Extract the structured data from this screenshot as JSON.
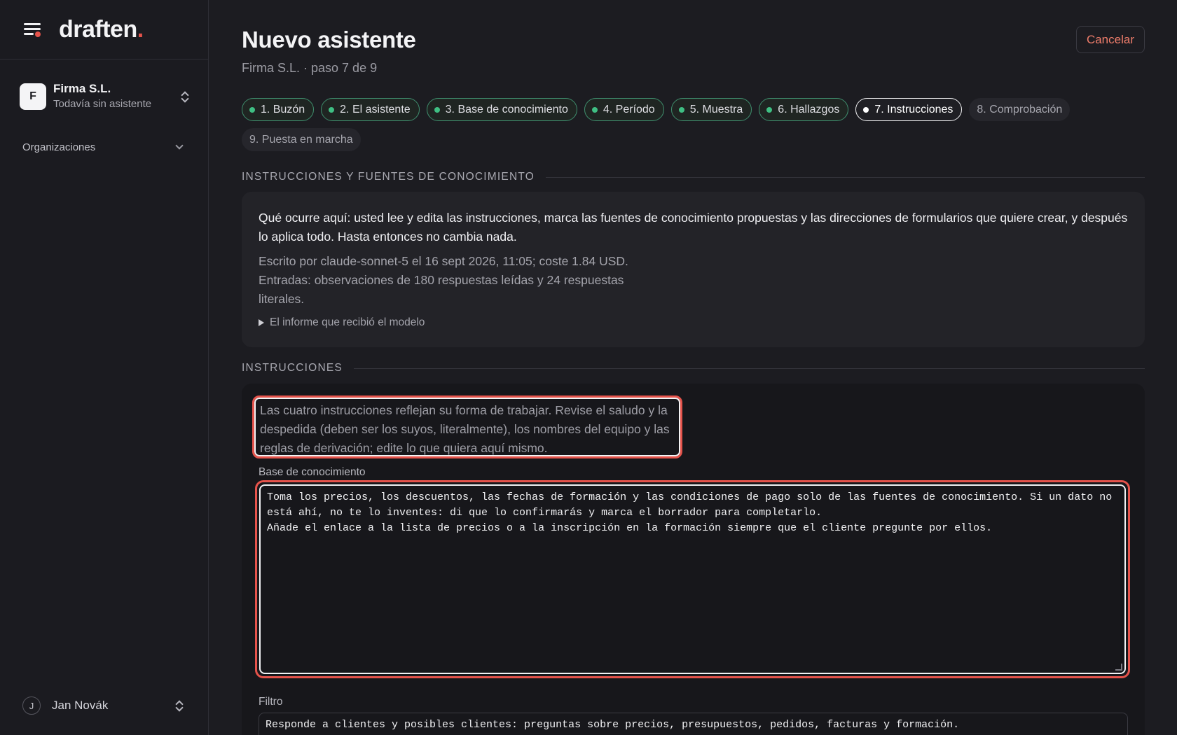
{
  "app": {
    "logo": "draften",
    "logo_dot": "."
  },
  "sidebar": {
    "org": {
      "initial": "F",
      "name": "Firma S.L.",
      "subtitle": "Todavía sin asistente"
    },
    "section_label": "Organizaciones",
    "user": {
      "initial": "J",
      "name": "Jan Novák"
    }
  },
  "header": {
    "title": "Nuevo asistente",
    "subtitle": "Firma S.L. · paso 7 de 9",
    "cancel_label": "Cancelar"
  },
  "steps": [
    {
      "label": "1. Buzón",
      "state": "done"
    },
    {
      "label": "2. El asistente",
      "state": "done"
    },
    {
      "label": "3. Base de conocimiento",
      "state": "done"
    },
    {
      "label": "4. Período",
      "state": "done"
    },
    {
      "label": "5. Muestra",
      "state": "done"
    },
    {
      "label": "6. Hallazgos",
      "state": "done"
    },
    {
      "label": "7. Instrucciones",
      "state": "active"
    },
    {
      "label": "8. Comprobación",
      "state": "todo"
    },
    {
      "label": "9. Puesta en marcha",
      "state": "todo"
    }
  ],
  "section1": {
    "heading": "INSTRUCCIONES Y FUENTES DE CONOCIMIENTO",
    "intro": "Qué ocurre aquí: usted lee y edita las instrucciones, marca las fuentes de conocimiento propuestas y las direcciones de formularios que quiere crear, y después lo aplica todo. Hasta entonces no cambia nada.",
    "meta_written": "Escrito por claude-sonnet-5 el 16 sept 2026, 11:05; coste 1.84 USD.",
    "meta_inputs": "Entradas: observaciones de 180 respuestas leídas y 24 respuestas literales.",
    "details_label": "El informe que recibió el modelo"
  },
  "section2": {
    "heading": "INSTRUCCIONES",
    "hint": "Las cuatro instrucciones reflejan su forma de trabajar. Revise el saludo y la despedida (deben ser los suyos, literalmente), los nombres del equipo y las reglas de derivación; edite lo que quiera aquí mismo.",
    "kb_label": "Base de conocimiento",
    "kb_value": "Toma los precios, los descuentos, las fechas de formación y las condiciones de pago solo de las fuentes de conocimiento. Si un dato no está ahí, no te lo inventes: di que lo confirmarás y marca el borrador para completarlo.\nAñade el enlace a la lista de precios o a la inscripción en la formación siempre que el cliente pregunte por ellos.",
    "filter_label": "Filtro",
    "filter_value": "Responde a clientes y posibles clientes: preguntas sobre precios, presupuestos, pedidos, facturas y formación."
  },
  "colors": {
    "accent": "#e5534b",
    "done": "#3fbf83",
    "cancel": "#ef7d6b"
  }
}
